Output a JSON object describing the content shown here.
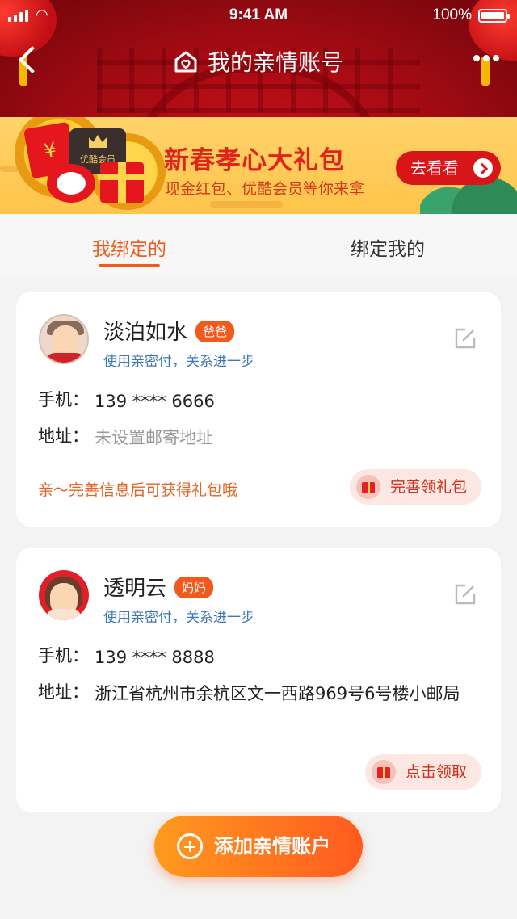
{
  "status_bar": {
    "time": "9:41 AM",
    "battery": "100%"
  },
  "header": {
    "title": "我的亲情账号",
    "icons": {
      "back": "chevron-left-icon",
      "home": "home-heart-icon",
      "more": "more-dots-icon"
    }
  },
  "banner": {
    "title": "新春孝心大礼包",
    "subtitle": "现金红包、优酷会员等你来拿",
    "button": "去看看",
    "vip_label": "优酷会员",
    "redbag_symbol": "¥"
  },
  "tabs": [
    {
      "label": "我绑定的",
      "active": true
    },
    {
      "label": "绑定我的",
      "active": false
    }
  ],
  "accounts": [
    {
      "name": "淡泊如水",
      "relation": "爸爸",
      "hint": "使用亲密付，关系进一步",
      "phone_label": "手机：",
      "phone": "139 **** 6666",
      "address_label": "地址：",
      "address": "未设置邮寄地址",
      "promo": "亲～完善信息后可获得礼包哦",
      "action": "完善领礼包"
    },
    {
      "name": "透明云",
      "relation": "妈妈",
      "hint": "使用亲密付，关系进一步",
      "phone_label": "手机：",
      "phone": "139 **** 8888",
      "address_label": "地址：",
      "address": "浙江省杭州市余杭区文一西路969号6号楼小邮局",
      "action": "点击领取"
    }
  ],
  "add_button": "添加亲情账户",
  "colors": {
    "accent": "#f05a1e",
    "hero_red": "#c8101a",
    "banner_yellow": "#ffc44a",
    "link_blue": "#3c78b8"
  }
}
